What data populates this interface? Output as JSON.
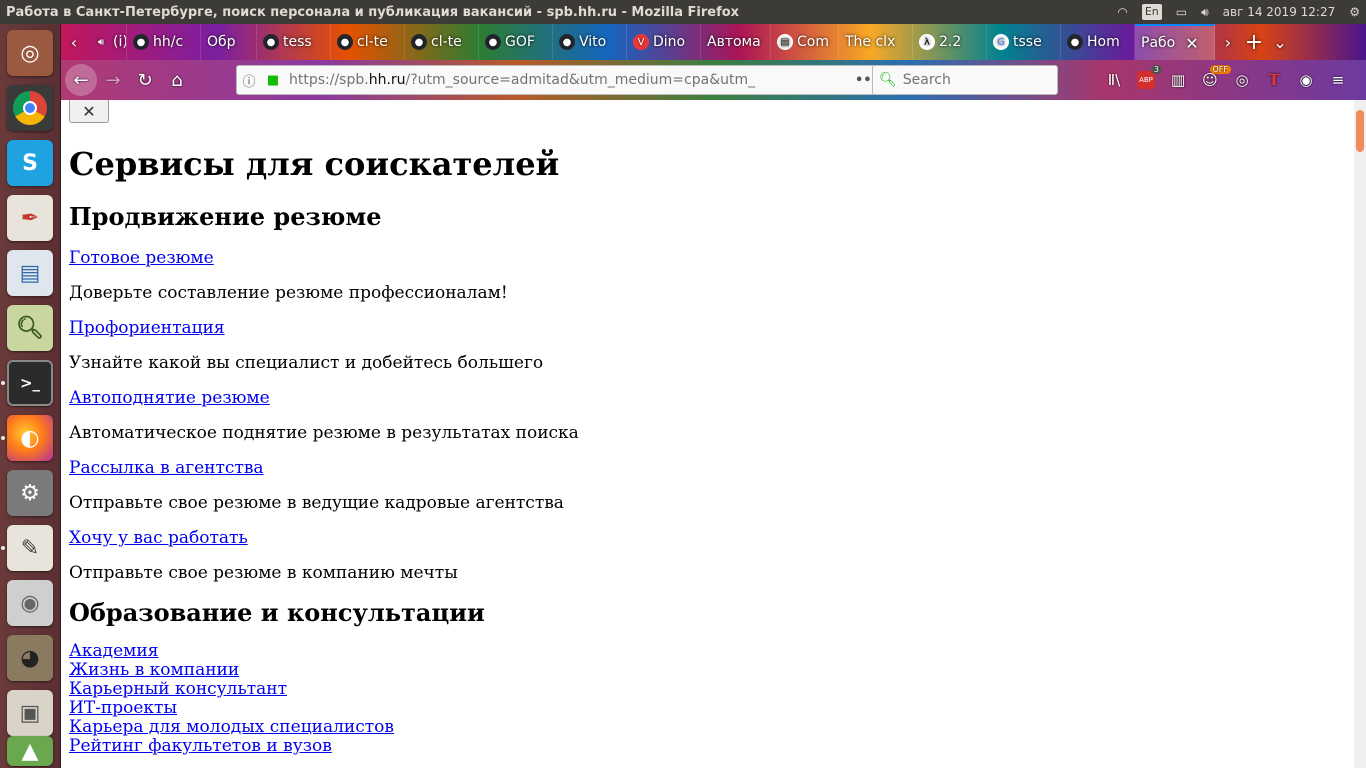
{
  "top_panel": {
    "window_title": "Работа в Санкт-Петербурге, поиск персонала и публикация вакансий - spb.hh.ru - Mozilla Firefox",
    "lang": "En",
    "datetime": "авг 14 2019 12:27"
  },
  "launcher": {
    "items": [
      "ubuntu-dash",
      "chrome",
      "skype",
      "document-viewer",
      "libreoffice-impress",
      "image-viewer",
      "terminal",
      "firefox",
      "system-settings",
      "text-editor",
      "dvd",
      "gimp",
      "files",
      "software-updater"
    ]
  },
  "tabs": [
    {
      "label": "(i)",
      "fav": "audio-icon"
    },
    {
      "label": "hh/c",
      "fav": "github-icon"
    },
    {
      "label": "Обр",
      "fav": ""
    },
    {
      "label": "tess",
      "fav": "github-icon"
    },
    {
      "label": "cl-te",
      "fav": "github-icon"
    },
    {
      "label": "cl-te",
      "fav": "github-icon"
    },
    {
      "label": "GOF",
      "fav": "github-icon"
    },
    {
      "label": "Vito",
      "fav": "github-icon"
    },
    {
      "label": "Dino",
      "fav": "vivaldi-icon"
    },
    {
      "label": "Автома",
      "fav": ""
    },
    {
      "label": "Com",
      "fav": "document-icon"
    },
    {
      "label": "The clx",
      "fav": ""
    },
    {
      "label": "2.2",
      "fav": "lambda-icon"
    },
    {
      "label": "tsse",
      "fav": "google-icon"
    },
    {
      "label": "Hom",
      "fav": "github-icon"
    },
    {
      "label": "Рабо",
      "fav": "",
      "active": true
    }
  ],
  "navbar": {
    "url_prefix": "https://spb.",
    "url_domain": "hh.ru",
    "url_rest": "/?utm_source=admitad&utm_medium=cpa&utm_",
    "search_placeholder": "Search",
    "abp_count": "3",
    "off_badge": "OFF"
  },
  "page": {
    "close_label": "✕",
    "title": "Сервисы для соискателей",
    "section1_title": "Продвижение резюме",
    "services": [
      {
        "link": "Готовое резюме",
        "desc": "Доверьте составление резюме профессионалам!"
      },
      {
        "link": "Профориентация",
        "desc": "Узнайте какой вы специалист и добейтесь большего"
      },
      {
        "link": "Автоподнятие резюме",
        "desc": "Автоматическое поднятие резюме в результатах поиска"
      },
      {
        "link": "Рассылка в агентства",
        "desc": "Отправьте свое резюме в ведущие кадровые агентства"
      },
      {
        "link": "Хочу у вас работать",
        "desc": "Отправьте свое резюме в компанию мечты"
      }
    ],
    "section2_title": "Образование и консультации",
    "education_links": [
      "Академия",
      "Жизнь в компании",
      "Карьерный консультант",
      "ИТ-проекты",
      "Карьера для молодых специалистов",
      "Рейтинг факультетов и вузов"
    ]
  }
}
